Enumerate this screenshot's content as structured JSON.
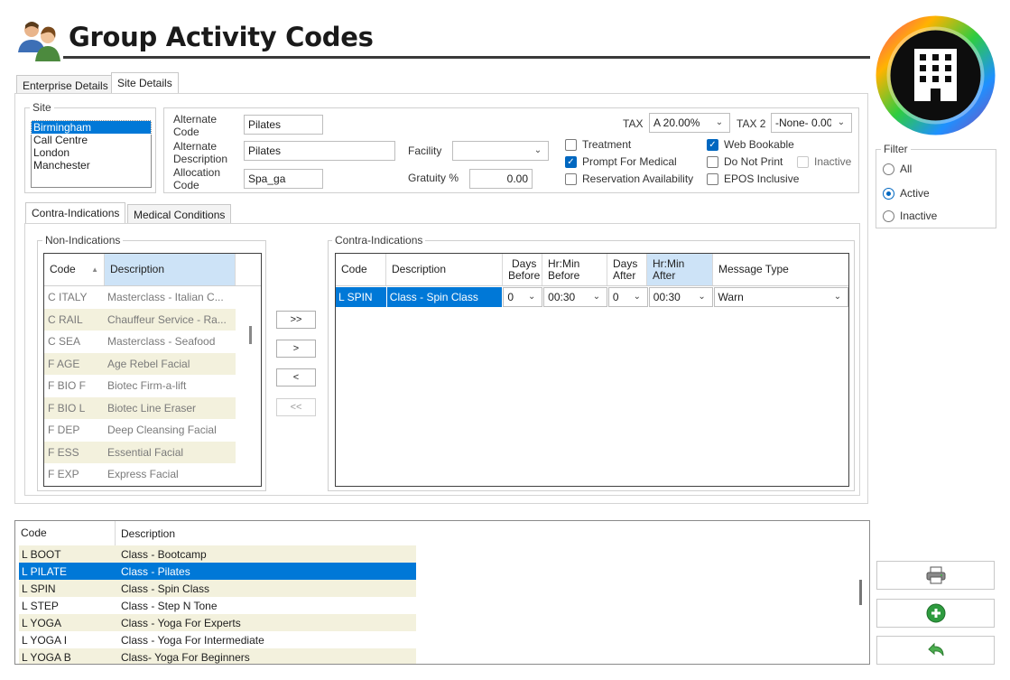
{
  "window": {
    "title": "Group Activity Codes"
  },
  "top_tabs": [
    {
      "label": "Enterprise Details",
      "active": false
    },
    {
      "label": "Site Details",
      "active": true
    }
  ],
  "site": {
    "group_label": "Site",
    "items": [
      "Birmingham",
      "Call Centre",
      "London",
      "Manchester"
    ],
    "selected": "Birmingham"
  },
  "fields": {
    "alt_code_label": "Alternate Code",
    "alt_code": "Pilates",
    "alt_desc_label": "Alternate Description",
    "alt_desc": "Pilates",
    "alloc_code_label": "Allocation Code",
    "alloc_code": "Spa_ga",
    "facility_label": "Facility",
    "facility": "",
    "gratuity_label": "Gratuity %",
    "gratuity": "0.00",
    "tax_label": "TAX",
    "tax": "A 20.00%",
    "tax2_label": "TAX 2",
    "tax2": "-None- 0.00"
  },
  "checkboxes": {
    "treatment": {
      "label": "Treatment",
      "checked": false
    },
    "prompt_medical": {
      "label": "Prompt For Medical",
      "checked": true
    },
    "reservation": {
      "label": "Reservation Availability",
      "checked": false
    },
    "web_bookable": {
      "label": "Web Bookable",
      "checked": true
    },
    "do_not_print": {
      "label": "Do Not Print",
      "checked": false
    },
    "epos_inclusive": {
      "label": "EPOS Inclusive",
      "checked": false
    },
    "inactive": {
      "label": "Inactive",
      "checked": false
    }
  },
  "inner_tabs": [
    {
      "label": "Contra-Indications",
      "active": true
    },
    {
      "label": "Medical Conditions",
      "active": false
    }
  ],
  "non_indications": {
    "group_label": "Non-Indications",
    "col_code": "Code",
    "col_desc": "Description",
    "rows": [
      {
        "code": "C ITALY",
        "desc": "Masterclass - Italian C..."
      },
      {
        "code": "C RAIL",
        "desc": "Chauffeur Service - Ra..."
      },
      {
        "code": "C SEA",
        "desc": "Masterclass - Seafood"
      },
      {
        "code": "F AGE",
        "desc": "Age Rebel Facial"
      },
      {
        "code": "F BIO F",
        "desc": "Biotec Firm-a-lift"
      },
      {
        "code": "F BIO L",
        "desc": "Biotec Line Eraser"
      },
      {
        "code": "F DEP",
        "desc": "Deep Cleansing Facial"
      },
      {
        "code": "F ESS",
        "desc": "Essential Facial"
      },
      {
        "code": "F EXP",
        "desc": "Express Facial"
      }
    ]
  },
  "move_buttons": {
    "add_all": ">>",
    "add": ">",
    "remove": "<",
    "remove_all": "<<"
  },
  "contra_indications": {
    "group_label": "Contra-Indications",
    "col_code": "Code",
    "col_desc": "Description",
    "col_days_before": "Days Before",
    "col_hrmin_before": "Hr:Min Before",
    "col_days_after": "Days After",
    "col_hrmin_after": "Hr:Min After",
    "col_msg_type": "Message Type",
    "rows": [
      {
        "code": "L SPIN",
        "desc": "Class - Spin Class",
        "days_before": "0",
        "hrmin_before": "00:30",
        "days_after": "0",
        "hrmin_after": "00:30",
        "msg_type": "Warn"
      }
    ]
  },
  "filter": {
    "label": "Filter",
    "options": [
      "All",
      "Active",
      "Inactive"
    ],
    "selected": "Active"
  },
  "bottom_list": {
    "col_code": "Code",
    "col_desc": "Description",
    "rows": [
      {
        "code": "L BOOT",
        "desc": "Class - Bootcamp"
      },
      {
        "code": "L PILATE",
        "desc": "Class - Pilates"
      },
      {
        "code": "L SPIN",
        "desc": "Class - Spin Class"
      },
      {
        "code": "L STEP",
        "desc": "Class - Step N Tone"
      },
      {
        "code": "L YOGA",
        "desc": "Class - Yoga For Experts"
      },
      {
        "code": "L YOGA I",
        "desc": "Class - Yoga For Intermediate"
      },
      {
        "code": "L YOGA B",
        "desc": "Class- Yoga For Beginners"
      }
    ],
    "selected_index": 1
  },
  "icons": {
    "app": "users-icon",
    "logo": "building-icon",
    "print": "printer-icon",
    "add": "add-circle-icon",
    "undo": "undo-icon"
  },
  "colors": {
    "accent": "#0078d7",
    "alt_row": "#f3f1dd",
    "sorted_header": "#cde3f7"
  }
}
